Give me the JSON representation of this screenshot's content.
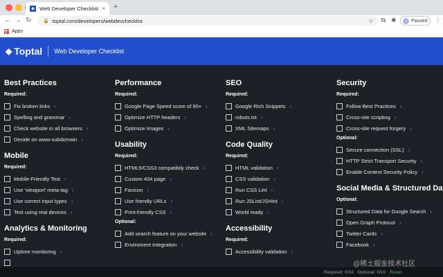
{
  "browser": {
    "tab_title": "Web Developer Checklist: Web",
    "tab_close": "×",
    "new_tab": "+",
    "url": "toptal.com/developers/webdevchecklist",
    "profile_status": "Paused",
    "bookmark_apps": "Apps"
  },
  "header": {
    "logo_text": "Toptal",
    "logo_mark": "◆",
    "page_title": "Web Developer Checklist",
    "background_color": "#204ecf"
  },
  "columns": [
    {
      "sections": [
        {
          "title": "Best Practices",
          "groups": [
            {
              "label": "Required:",
              "items": [
                "Fix broken links",
                "Spelling and grammar",
                "Check website in all browsers",
                "Decide on www-subdomain"
              ]
            }
          ]
        },
        {
          "title": "Mobile",
          "groups": [
            {
              "label": "Required:",
              "items": [
                "Mobile-Friendly Test",
                "Use 'viewport' meta-tag",
                "Use correct input types",
                "Test using real devices"
              ]
            }
          ]
        },
        {
          "title": "Analytics & Monitoring",
          "groups": [
            {
              "label": "Required:",
              "items": [
                "Uptime monitoring",
                ""
              ]
            }
          ]
        }
      ]
    },
    {
      "sections": [
        {
          "title": "Performance",
          "groups": [
            {
              "label": "Required:",
              "items": [
                "Google Page Speed score of 90+",
                "Optimize HTTP headers",
                "Optimize Images"
              ]
            }
          ]
        },
        {
          "title": "Usability",
          "groups": [
            {
              "label": "Required:",
              "items": [
                "HTML5/CSS3 compatibily check",
                "Custom 404 page",
                "Favicon",
                "Use friendly URLs",
                "Print-friendly CSS"
              ]
            },
            {
              "label": "Optional:",
              "items": [
                "Add search feature on your website",
                "Enviroment Integration"
              ]
            }
          ]
        }
      ]
    },
    {
      "sections": [
        {
          "title": "SEO",
          "groups": [
            {
              "label": "Required:",
              "items": [
                "Google Rich Snippets",
                "robots.txt",
                "XML Sitemaps"
              ]
            }
          ]
        },
        {
          "title": "Code Quality",
          "groups": [
            {
              "label": "Required:",
              "items": [
                "HTML validation",
                "CSS validation",
                "Run CSS Lint",
                "Run JSLint/JSHint",
                "World ready"
              ]
            }
          ]
        },
        {
          "title": "Accessibility",
          "groups": [
            {
              "label": "Required:",
              "items": [
                "Accessibility validation"
              ]
            }
          ]
        }
      ]
    },
    {
      "sections": [
        {
          "title": "Security",
          "groups": [
            {
              "label": "Required:",
              "items": [
                "Follow Best Practices",
                "Cross-site scripting",
                "Cross-site request forgery"
              ]
            },
            {
              "label": "Optional:",
              "items": [
                "Secure connection (SSL)",
                "HTTP Strict Transport Security",
                "Enable Content Security Policy"
              ]
            }
          ]
        },
        {
          "title": "Social Media & Structured Data",
          "groups": [
            {
              "label": "Optional:",
              "items": [
                "Structured Data for Google Search",
                "Open Graph Protocol",
                "Twitter Cards",
                "Facebook"
              ]
            }
          ]
        }
      ]
    }
  ],
  "footer": {
    "required": "Required: 0/34",
    "optional": "Optional: 0/10",
    "reset": "Reset"
  },
  "watermark": "@稀土掘金技术社区",
  "colors": {
    "page_bg": "#1c2027",
    "accent": "#3a8ef6",
    "reset": "#3fb950"
  }
}
